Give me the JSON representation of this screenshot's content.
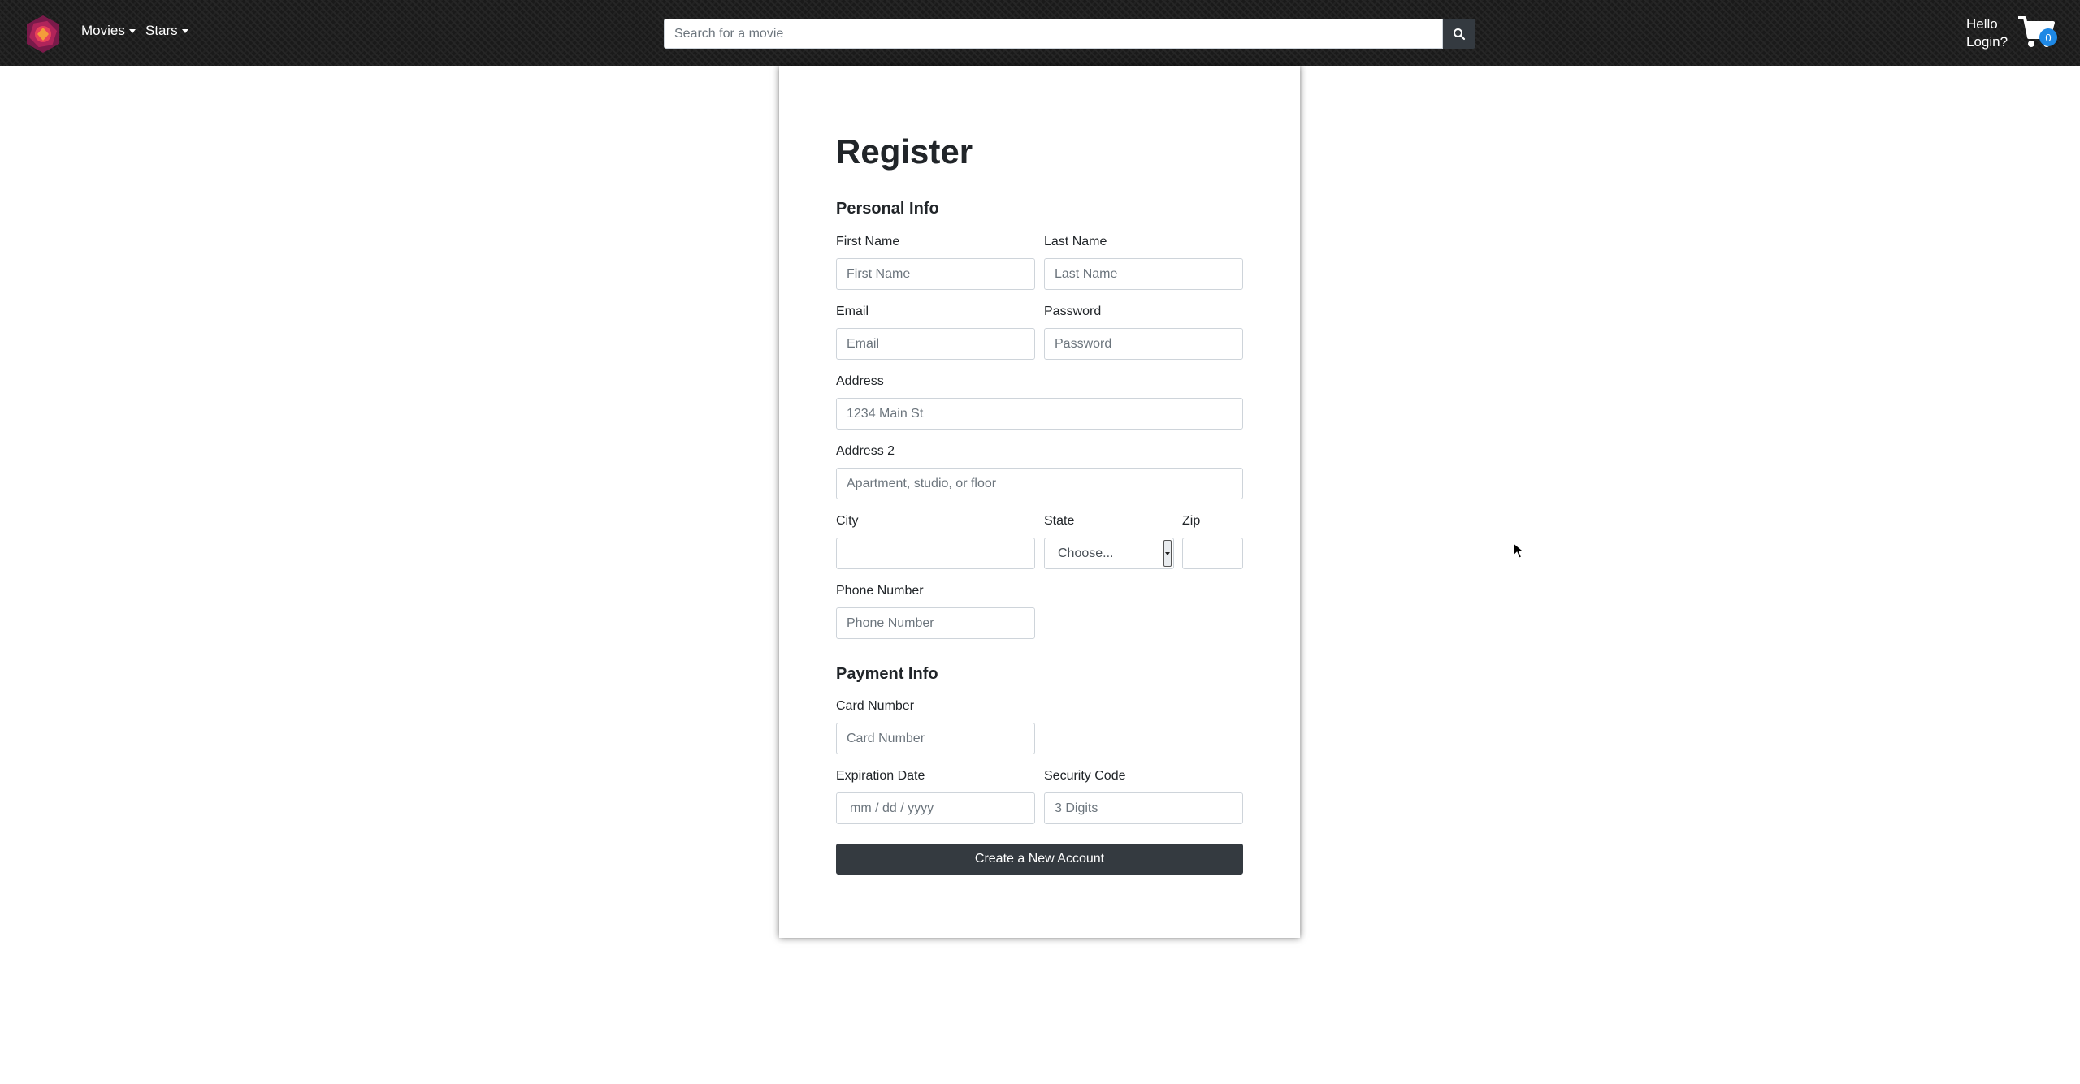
{
  "navbar": {
    "menus": [
      {
        "label": "Movies"
      },
      {
        "label": "Stars"
      }
    ],
    "search": {
      "placeholder": "Search for a movie",
      "value": ""
    },
    "greeting": "Hello",
    "login_label": "Login?",
    "cart_count": "0",
    "colors": {
      "background": "#1a1a1a",
      "badge": "#1e88e5"
    }
  },
  "form": {
    "title": "Register",
    "personal_section": "Personal Info",
    "fields": {
      "first_name": {
        "label": "First Name",
        "placeholder": "First Name",
        "value": ""
      },
      "last_name": {
        "label": "Last Name",
        "placeholder": "Last Name",
        "value": ""
      },
      "email": {
        "label": "Email",
        "placeholder": "Email",
        "value": ""
      },
      "password": {
        "label": "Password",
        "placeholder": "Password",
        "value": ""
      },
      "address": {
        "label": "Address",
        "placeholder": "1234 Main St",
        "value": ""
      },
      "address2": {
        "label": "Address 2",
        "placeholder": "Apartment, studio, or floor",
        "value": ""
      },
      "city": {
        "label": "City",
        "placeholder": "",
        "value": ""
      },
      "state": {
        "label": "State",
        "selected": "Choose..."
      },
      "zip": {
        "label": "Zip",
        "placeholder": "",
        "value": ""
      },
      "phone": {
        "label": "Phone Number",
        "placeholder": "Phone Number",
        "value": ""
      }
    },
    "payment_section": "Payment Info",
    "payment": {
      "card_number": {
        "label": "Card Number",
        "placeholder": "Card Number",
        "value": ""
      },
      "expiration": {
        "label": "Expiration Date",
        "placeholder": "mm / dd / yyyy",
        "value": ""
      },
      "security_code": {
        "label": "Security Code",
        "placeholder": "3 Digits",
        "value": ""
      }
    },
    "submit_label": "Create a New Account",
    "colors": {
      "button": "#343a40"
    }
  }
}
